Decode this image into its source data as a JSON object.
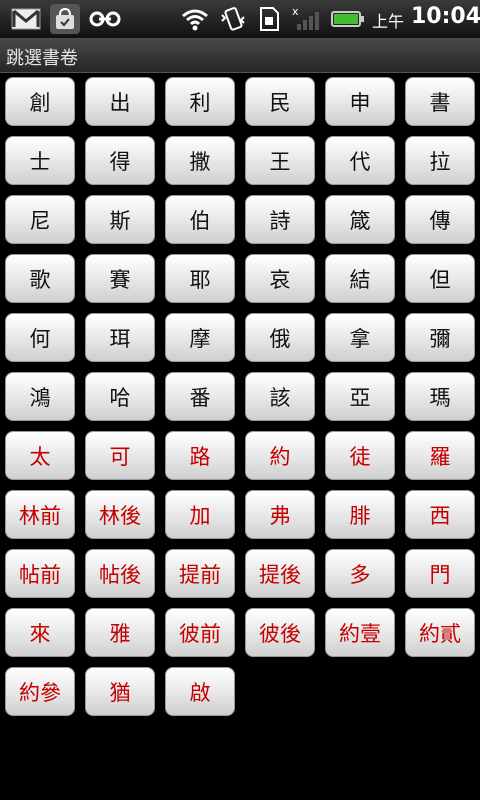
{
  "status_bar": {
    "ampm": "上午",
    "time": "10:04",
    "icons": [
      "gmail-icon",
      "market-icon",
      "link-icon",
      "wifi-icon",
      "vibrate-icon",
      "sd-card-icon",
      "signal-icon",
      "battery-icon"
    ],
    "battery_color": "#3fbf2f"
  },
  "title": "跳選書卷",
  "books": [
    {
      "label": "創",
      "testament": "old"
    },
    {
      "label": "出",
      "testament": "old"
    },
    {
      "label": "利",
      "testament": "old"
    },
    {
      "label": "民",
      "testament": "old"
    },
    {
      "label": "申",
      "testament": "old"
    },
    {
      "label": "書",
      "testament": "old"
    },
    {
      "label": "士",
      "testament": "old"
    },
    {
      "label": "得",
      "testament": "old"
    },
    {
      "label": "撒",
      "testament": "old"
    },
    {
      "label": "王",
      "testament": "old"
    },
    {
      "label": "代",
      "testament": "old"
    },
    {
      "label": "拉",
      "testament": "old"
    },
    {
      "label": "尼",
      "testament": "old"
    },
    {
      "label": "斯",
      "testament": "old"
    },
    {
      "label": "伯",
      "testament": "old"
    },
    {
      "label": "詩",
      "testament": "old"
    },
    {
      "label": "箴",
      "testament": "old"
    },
    {
      "label": "傳",
      "testament": "old"
    },
    {
      "label": "歌",
      "testament": "old"
    },
    {
      "label": "賽",
      "testament": "old"
    },
    {
      "label": "耶",
      "testament": "old"
    },
    {
      "label": "哀",
      "testament": "old"
    },
    {
      "label": "結",
      "testament": "old"
    },
    {
      "label": "但",
      "testament": "old"
    },
    {
      "label": "何",
      "testament": "old"
    },
    {
      "label": "珥",
      "testament": "old"
    },
    {
      "label": "摩",
      "testament": "old"
    },
    {
      "label": "俄",
      "testament": "old"
    },
    {
      "label": "拿",
      "testament": "old"
    },
    {
      "label": "彌",
      "testament": "old"
    },
    {
      "label": "鴻",
      "testament": "old"
    },
    {
      "label": "哈",
      "testament": "old"
    },
    {
      "label": "番",
      "testament": "old"
    },
    {
      "label": "該",
      "testament": "old"
    },
    {
      "label": "亞",
      "testament": "old"
    },
    {
      "label": "瑪",
      "testament": "old"
    },
    {
      "label": "太",
      "testament": "new"
    },
    {
      "label": "可",
      "testament": "new"
    },
    {
      "label": "路",
      "testament": "new"
    },
    {
      "label": "約",
      "testament": "new"
    },
    {
      "label": "徒",
      "testament": "new"
    },
    {
      "label": "羅",
      "testament": "new"
    },
    {
      "label": "林前",
      "testament": "new"
    },
    {
      "label": "林後",
      "testament": "new"
    },
    {
      "label": "加",
      "testament": "new"
    },
    {
      "label": "弗",
      "testament": "new"
    },
    {
      "label": "腓",
      "testament": "new"
    },
    {
      "label": "西",
      "testament": "new"
    },
    {
      "label": "帖前",
      "testament": "new"
    },
    {
      "label": "帖後",
      "testament": "new"
    },
    {
      "label": "提前",
      "testament": "new"
    },
    {
      "label": "提後",
      "testament": "new"
    },
    {
      "label": "多",
      "testament": "new"
    },
    {
      "label": "門",
      "testament": "new"
    },
    {
      "label": "來",
      "testament": "new"
    },
    {
      "label": "雅",
      "testament": "new"
    },
    {
      "label": "彼前",
      "testament": "new"
    },
    {
      "label": "彼後",
      "testament": "new"
    },
    {
      "label": "約壹",
      "testament": "new"
    },
    {
      "label": "約貳",
      "testament": "new"
    },
    {
      "label": "約參",
      "testament": "new"
    },
    {
      "label": "猶",
      "testament": "new"
    },
    {
      "label": "啟",
      "testament": "new"
    }
  ],
  "colors": {
    "old_testament_text": "#111111",
    "new_testament_text": "#c40000"
  }
}
